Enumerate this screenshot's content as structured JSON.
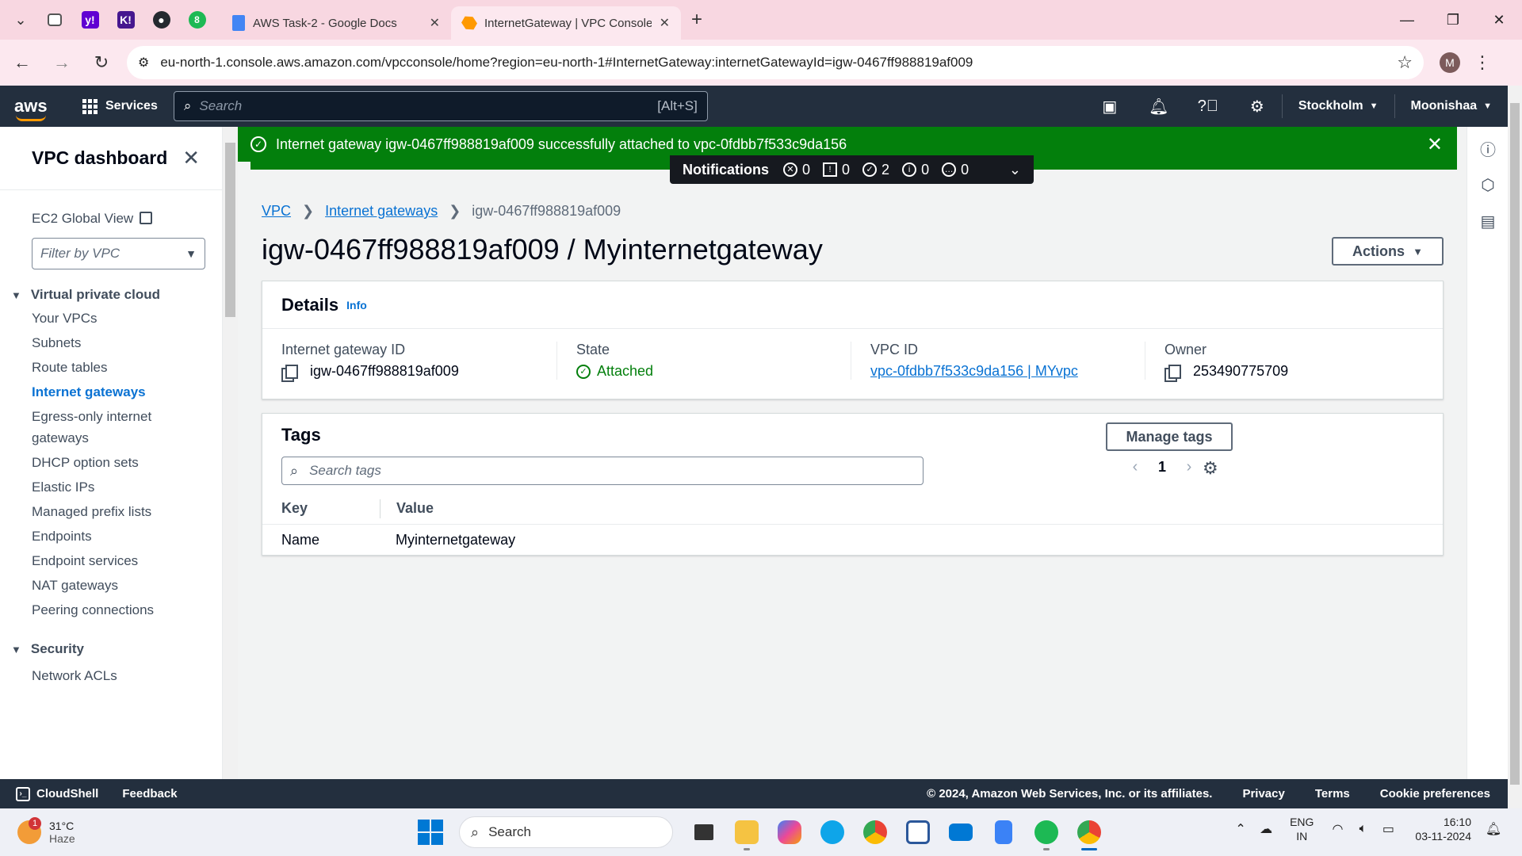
{
  "browser": {
    "tabs": [
      {
        "title": "AWS Task-2 - Google Docs",
        "active": false
      },
      {
        "title": "InternetGateway | VPC Console",
        "active": true
      }
    ],
    "pinned_badge": "8",
    "url": "eu-north-1.console.aws.amazon.com/vpcconsole/home?region=eu-north-1#InternetGateway:internetGatewayId=igw-0467ff988819af009",
    "profile_initial": "M"
  },
  "awsnav": {
    "logo": "aws",
    "services_label": "Services",
    "search_placeholder": "Search",
    "search_shortcut": "[Alt+S]",
    "region": "Stockholm",
    "user": "Moonishaa"
  },
  "sidebar": {
    "title": "VPC dashboard",
    "ec2_global_view": "EC2 Global View",
    "filter_placeholder": "Filter by VPC",
    "sections": [
      {
        "label": "Virtual private cloud",
        "items": [
          "Your VPCs",
          "Subnets",
          "Route tables",
          "Internet gateways",
          "Egress-only internet gateways",
          "DHCP option sets",
          "Elastic IPs",
          "Managed prefix lists",
          "Endpoints",
          "Endpoint services",
          "NAT gateways",
          "Peering connections"
        ]
      },
      {
        "label": "Security",
        "items": [
          "Network ACLs"
        ]
      }
    ],
    "active_item": "Internet gateways"
  },
  "flash": {
    "message": "Internet gateway igw-0467ff988819af009 successfully attached to vpc-0fdbb7f533c9da156"
  },
  "notifications": {
    "label": "Notifications",
    "counts": [
      {
        "icon": "error-icon",
        "glyph": "✕",
        "count": "0"
      },
      {
        "icon": "warning-icon",
        "glyph": "!",
        "count": "0"
      },
      {
        "icon": "success-icon",
        "glyph": "✓",
        "count": "2"
      },
      {
        "icon": "info-icon",
        "glyph": "i",
        "count": "0"
      },
      {
        "icon": "in-progress-icon",
        "glyph": "…",
        "count": "0"
      }
    ]
  },
  "breadcrumb": {
    "items": [
      "VPC",
      "Internet gateways"
    ],
    "current": "igw-0467ff988819af009"
  },
  "page": {
    "title": "igw-0467ff988819af009 / Myinternetgateway",
    "actions_label": "Actions"
  },
  "details": {
    "heading": "Details",
    "info_label": "Info",
    "fields": {
      "igw_id_label": "Internet gateway ID",
      "igw_id": "igw-0467ff988819af009",
      "state_label": "State",
      "state": "Attached",
      "vpc_id_label": "VPC ID",
      "vpc_id": "vpc-0fdbb7f533c9da156 | MYvpc",
      "owner_label": "Owner",
      "owner": "253490775709"
    }
  },
  "tags": {
    "heading": "Tags",
    "manage_label": "Manage tags",
    "search_placeholder": "Search tags",
    "page_number": "1",
    "columns": [
      "Key",
      "Value"
    ],
    "rows": [
      {
        "key": "Name",
        "value": "Myinternetgateway"
      }
    ]
  },
  "footer": {
    "cloudshell": "CloudShell",
    "feedback": "Feedback",
    "copyright": "© 2024, Amazon Web Services, Inc. or its affiliates.",
    "links": [
      "Privacy",
      "Terms",
      "Cookie preferences"
    ]
  },
  "taskbar": {
    "temp": "31°C",
    "condition": "Haze",
    "weather_badge": "1",
    "search_label": "Search",
    "lang_top": "ENG",
    "lang_bottom": "IN",
    "time": "16:10",
    "date": "03-11-2024"
  },
  "colors": {
    "aws_nav": "#232f3e",
    "success_green": "#037f0c",
    "link_blue": "#0972d3",
    "browser_tabbar": "#f8d7e1"
  }
}
